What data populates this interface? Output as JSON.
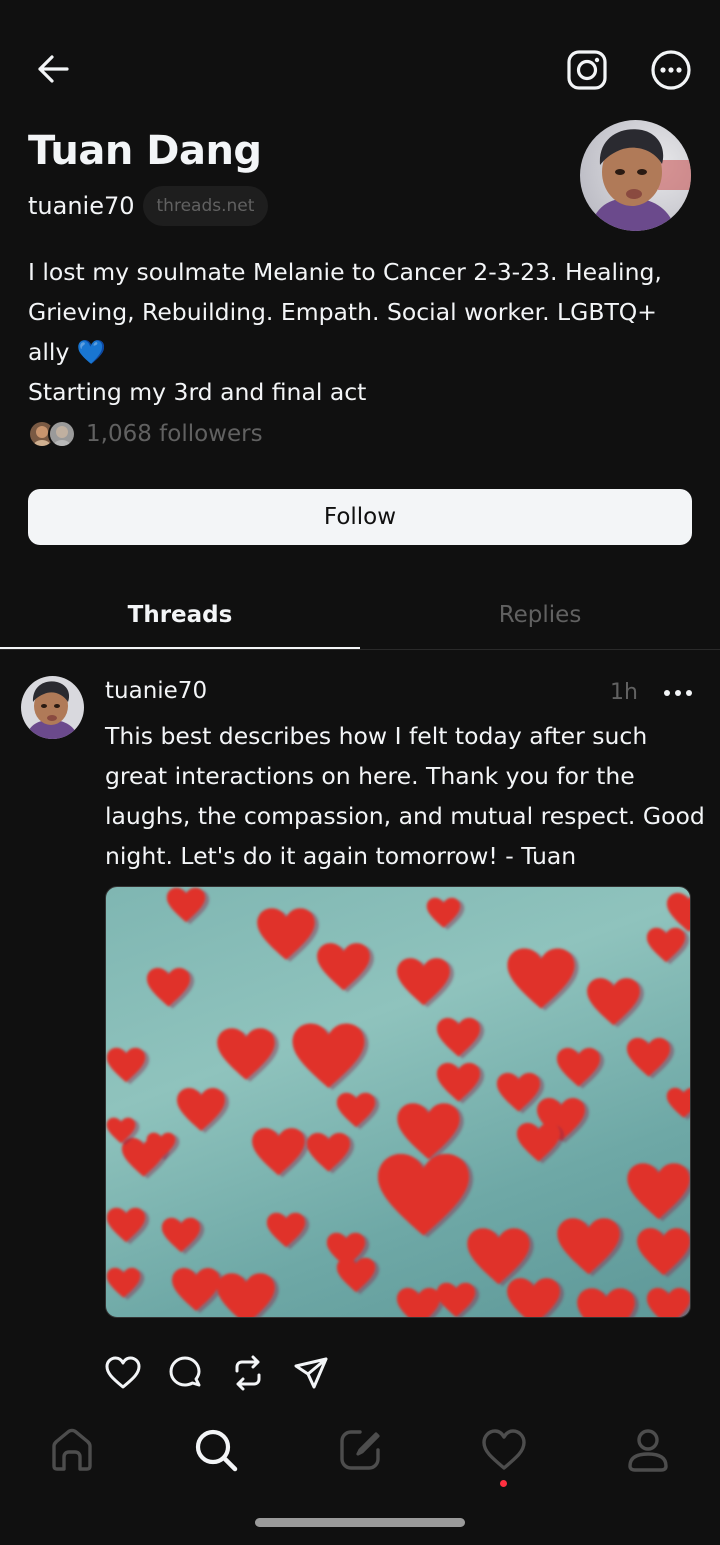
{
  "header": {
    "back_icon": "arrow-left-icon",
    "instagram_icon": "instagram-icon",
    "more_icon": "more-circle-icon"
  },
  "profile": {
    "name": "Tuan Dang",
    "handle": "tuanie70",
    "domain": "threads.net",
    "bio": "I lost my soulmate Melanie to Cancer 2-3-23.    Healing, Grieving, Rebuilding.  Empath.  Social worker. LGBTQ+ ally 💙\nStarting my 3rd and final act",
    "followers": "1,068 followers",
    "follow_label": "Follow"
  },
  "tabs": [
    {
      "label": "Threads",
      "active": true
    },
    {
      "label": "Replies",
      "active": false
    }
  ],
  "post": {
    "author": "tuanie70",
    "time": "1h",
    "text": "This best describes how I felt today after such great interactions on here.  Thank you for the laughs, the compassion, and mutual respect.  Good night.  Let's do it again tomorrow! - Tuan",
    "actions": [
      "heart-icon",
      "comment-icon",
      "repost-icon",
      "share-icon"
    ]
  },
  "bottom_nav": [
    {
      "icon": "home-icon",
      "active": false
    },
    {
      "icon": "search-icon",
      "active": true
    },
    {
      "icon": "compose-icon",
      "active": false
    },
    {
      "icon": "activity-heart-icon",
      "active": false,
      "notification_dot": true
    },
    {
      "icon": "profile-icon",
      "active": false
    }
  ],
  "colors": {
    "background": "#101010",
    "text_primary": "#f3f5f7",
    "text_secondary": "#616161",
    "notification": "#ff3040"
  }
}
